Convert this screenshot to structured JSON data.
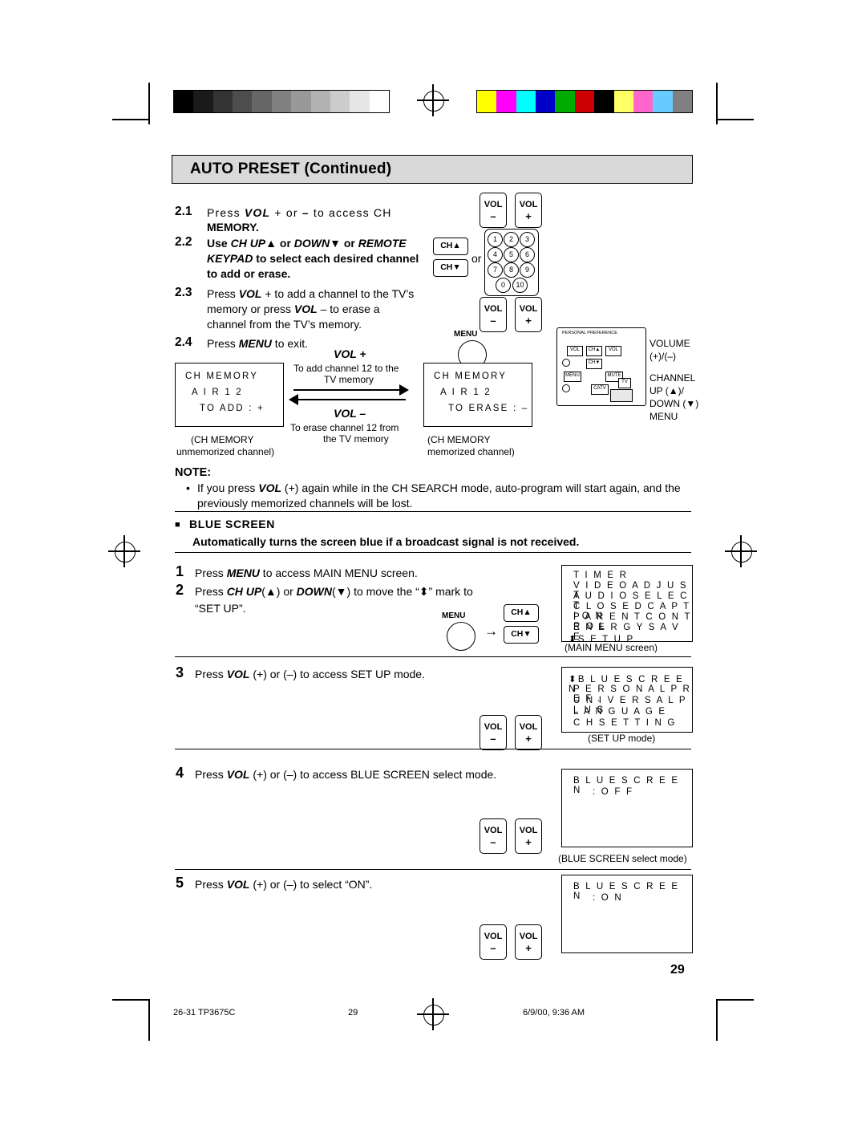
{
  "header": {
    "title": "AUTO PRESET (Continued)"
  },
  "page_number": "29",
  "steps_21_24": {
    "s21_num": "2.1",
    "s21_text_a": "Press ",
    "s21_vol": "VOL",
    "s21_text_b": " + or ",
    "s21_minus": "–",
    "s21_text_c": " to access CH",
    "s21_line2": "MEMORY.",
    "s22_num": "2.2",
    "s22_line1_a": "Use ",
    "s22_chup": "CH UP",
    "s22_tri_up": "▲",
    "s22_or": " or ",
    "s22_down": "DOWN",
    "s22_tri_dn": "▼",
    "s22_or2": " or ",
    "s22_remote": "REMOTE",
    "s22_line2_a": "KEYPAD",
    "s22_line2_b": " to select each desired channel",
    "s22_or3": "or",
    "s22_line3": "to add or erase.",
    "s23_num": "2.3",
    "s23_l1a": "Press ",
    "s23_vol": "VOL",
    "s23_l1b": " + to add a channel to the TV’s",
    "s23_l2a": "memory  or  press  ",
    "s23_vol2": "VOL",
    "s23_l2b": " – to erase a",
    "s23_l3": "channel from the TV’s memory.",
    "s24_num": "2.4",
    "s24_a": "Press ",
    "s24_menu": "MENU",
    "s24_b": " to exit."
  },
  "buttons": {
    "vol_label": "VOL",
    "vol_minus": "–",
    "vol_plus": "+",
    "ch_up": "CH▲",
    "ch_down": "CH▼",
    "menu": "MENU"
  },
  "keypad": {
    "keys": [
      "1",
      "2",
      "3",
      "4",
      "5",
      "6",
      "7",
      "8",
      "9",
      "0",
      "10"
    ]
  },
  "ch_memory_demo": {
    "vol_plus_title": "VOL +",
    "vol_plus_desc1": "To add channel 12 to the",
    "vol_plus_desc2": "TV memory",
    "vol_minus_title": "VOL –",
    "vol_minus_desc1": "To erase channel 12 from",
    "vol_minus_desc2": "the TV memory",
    "left_screen": {
      "l1": "CH MEMORY",
      "l2": "A I R    1 2",
      "l3": "TO ADD   : +"
    },
    "right_screen": {
      "l1": "CH MEMORY",
      "l2": "A I R    1 2",
      "l3": "TO ERASE : –"
    },
    "left_caption1": "(CH MEMORY",
    "left_caption2": "unmemorized channel)",
    "right_caption1": "(CH MEMORY",
    "right_caption2": "memorized channel)"
  },
  "tv_panel": {
    "personal_pref": "PERSONAL PREFERENCE",
    "vol_minus": "VOL",
    "vol_plus": "VOL",
    "ch_up": "CH▲",
    "ch_down": "CH▼",
    "menu": "MENU",
    "mute": "MUTE",
    "catv": "CATV",
    "tv": "TV"
  },
  "panel_legend": {
    "l1": "VOLUME",
    "l2": "(+)/(–)",
    "l3": "CHANNEL",
    "l4": "UP (▲)/",
    "l5": "DOWN (▼)",
    "l6": "MENU"
  },
  "note": {
    "title": "NOTE:",
    "bullet": "•",
    "t1": "If you press ",
    "t_vol": "VOL",
    "t2": " (+) again while in the CH SEARCH mode, auto-program will start again, and the",
    "t3": "previously memorized channels will be lost."
  },
  "blue_screen_section": {
    "marker": "■",
    "title": "BLUE SCREEN",
    "subtitle": "Automatically turns the screen blue if a broadcast signal is not received.",
    "step1_num": "1",
    "step1_a": "Press ",
    "step1_menu": "MENU",
    "step1_b": " to access MAIN MENU screen.",
    "step2_num": "2",
    "step2_a": "Press  ",
    "step2_chup": "CH UP",
    "step2_tri_up": "(▲)",
    "step2_or": "  or  ",
    "step2_down": "DOWN",
    "step2_tri_dn": "(▼)",
    "step2_b": "  to move the “",
    "step2_mark": "⬍",
    "step2_c": "” mark to",
    "step2_line2": "“SET UP”.",
    "step3_num": "3",
    "step3_a": "Press ",
    "step3_vol": "VOL",
    "step3_b": " (+) or (–) to access SET UP mode.",
    "step4_num": "4",
    "step4_a": "Press ",
    "step4_vol": "VOL",
    "step4_b": " (+) or (–) to access BLUE SCREEN select mode.",
    "step5_num": "5",
    "step5_a": "Press ",
    "step5_vol": "VOL",
    "step5_b": " (+) or (–) to select “ON”.",
    "arrow": "→"
  },
  "screens": {
    "main_menu": {
      "lines": [
        "T I M E R",
        "V I D E O   A D J U S T",
        "A U D I O   S E L E C T",
        "C L O S E D   C A P T I O N",
        "P A R E N T   C O N T R O L",
        "E N E R G Y   S A V E",
        "⬍S E T   U P"
      ],
      "caption": "(MAIN MENU screen)"
    },
    "set_up": {
      "lines": [
        "⬍B L U E   S C R E E N",
        "P E R S O N A L   P R E F .",
        "U N I V E R S A L   P L U S",
        "L A N G U A G E",
        "C H   S E T T I N G"
      ],
      "caption": "(SET UP mode)"
    },
    "blue_off": {
      "l1": "B L U E   S C R E E N",
      "l2": ": O F F",
      "caption": "(BLUE SCREEN select mode)"
    },
    "blue_on": {
      "l1": "B L U E   S C R E E N",
      "l2": ": O N"
    }
  },
  "footer": {
    "left": "26-31 TP3675C",
    "center": "29",
    "right": "6/9/00, 9:36 AM"
  },
  "colorbar": {
    "gray": [
      "#000000",
      "#1a1a1a",
      "#333333",
      "#4d4d4d",
      "#666666",
      "#808080",
      "#999999",
      "#b3b3b3",
      "#cccccc",
      "#e6e6e6",
      "#ffffff"
    ],
    "colors": [
      "#ffff00",
      "#ff00ff",
      "#00ffff",
      "#0000cc",
      "#00aa00",
      "#cc0000",
      "#000000",
      "#ffff66",
      "#ff66cc",
      "#66ccff",
      "#808080"
    ]
  }
}
